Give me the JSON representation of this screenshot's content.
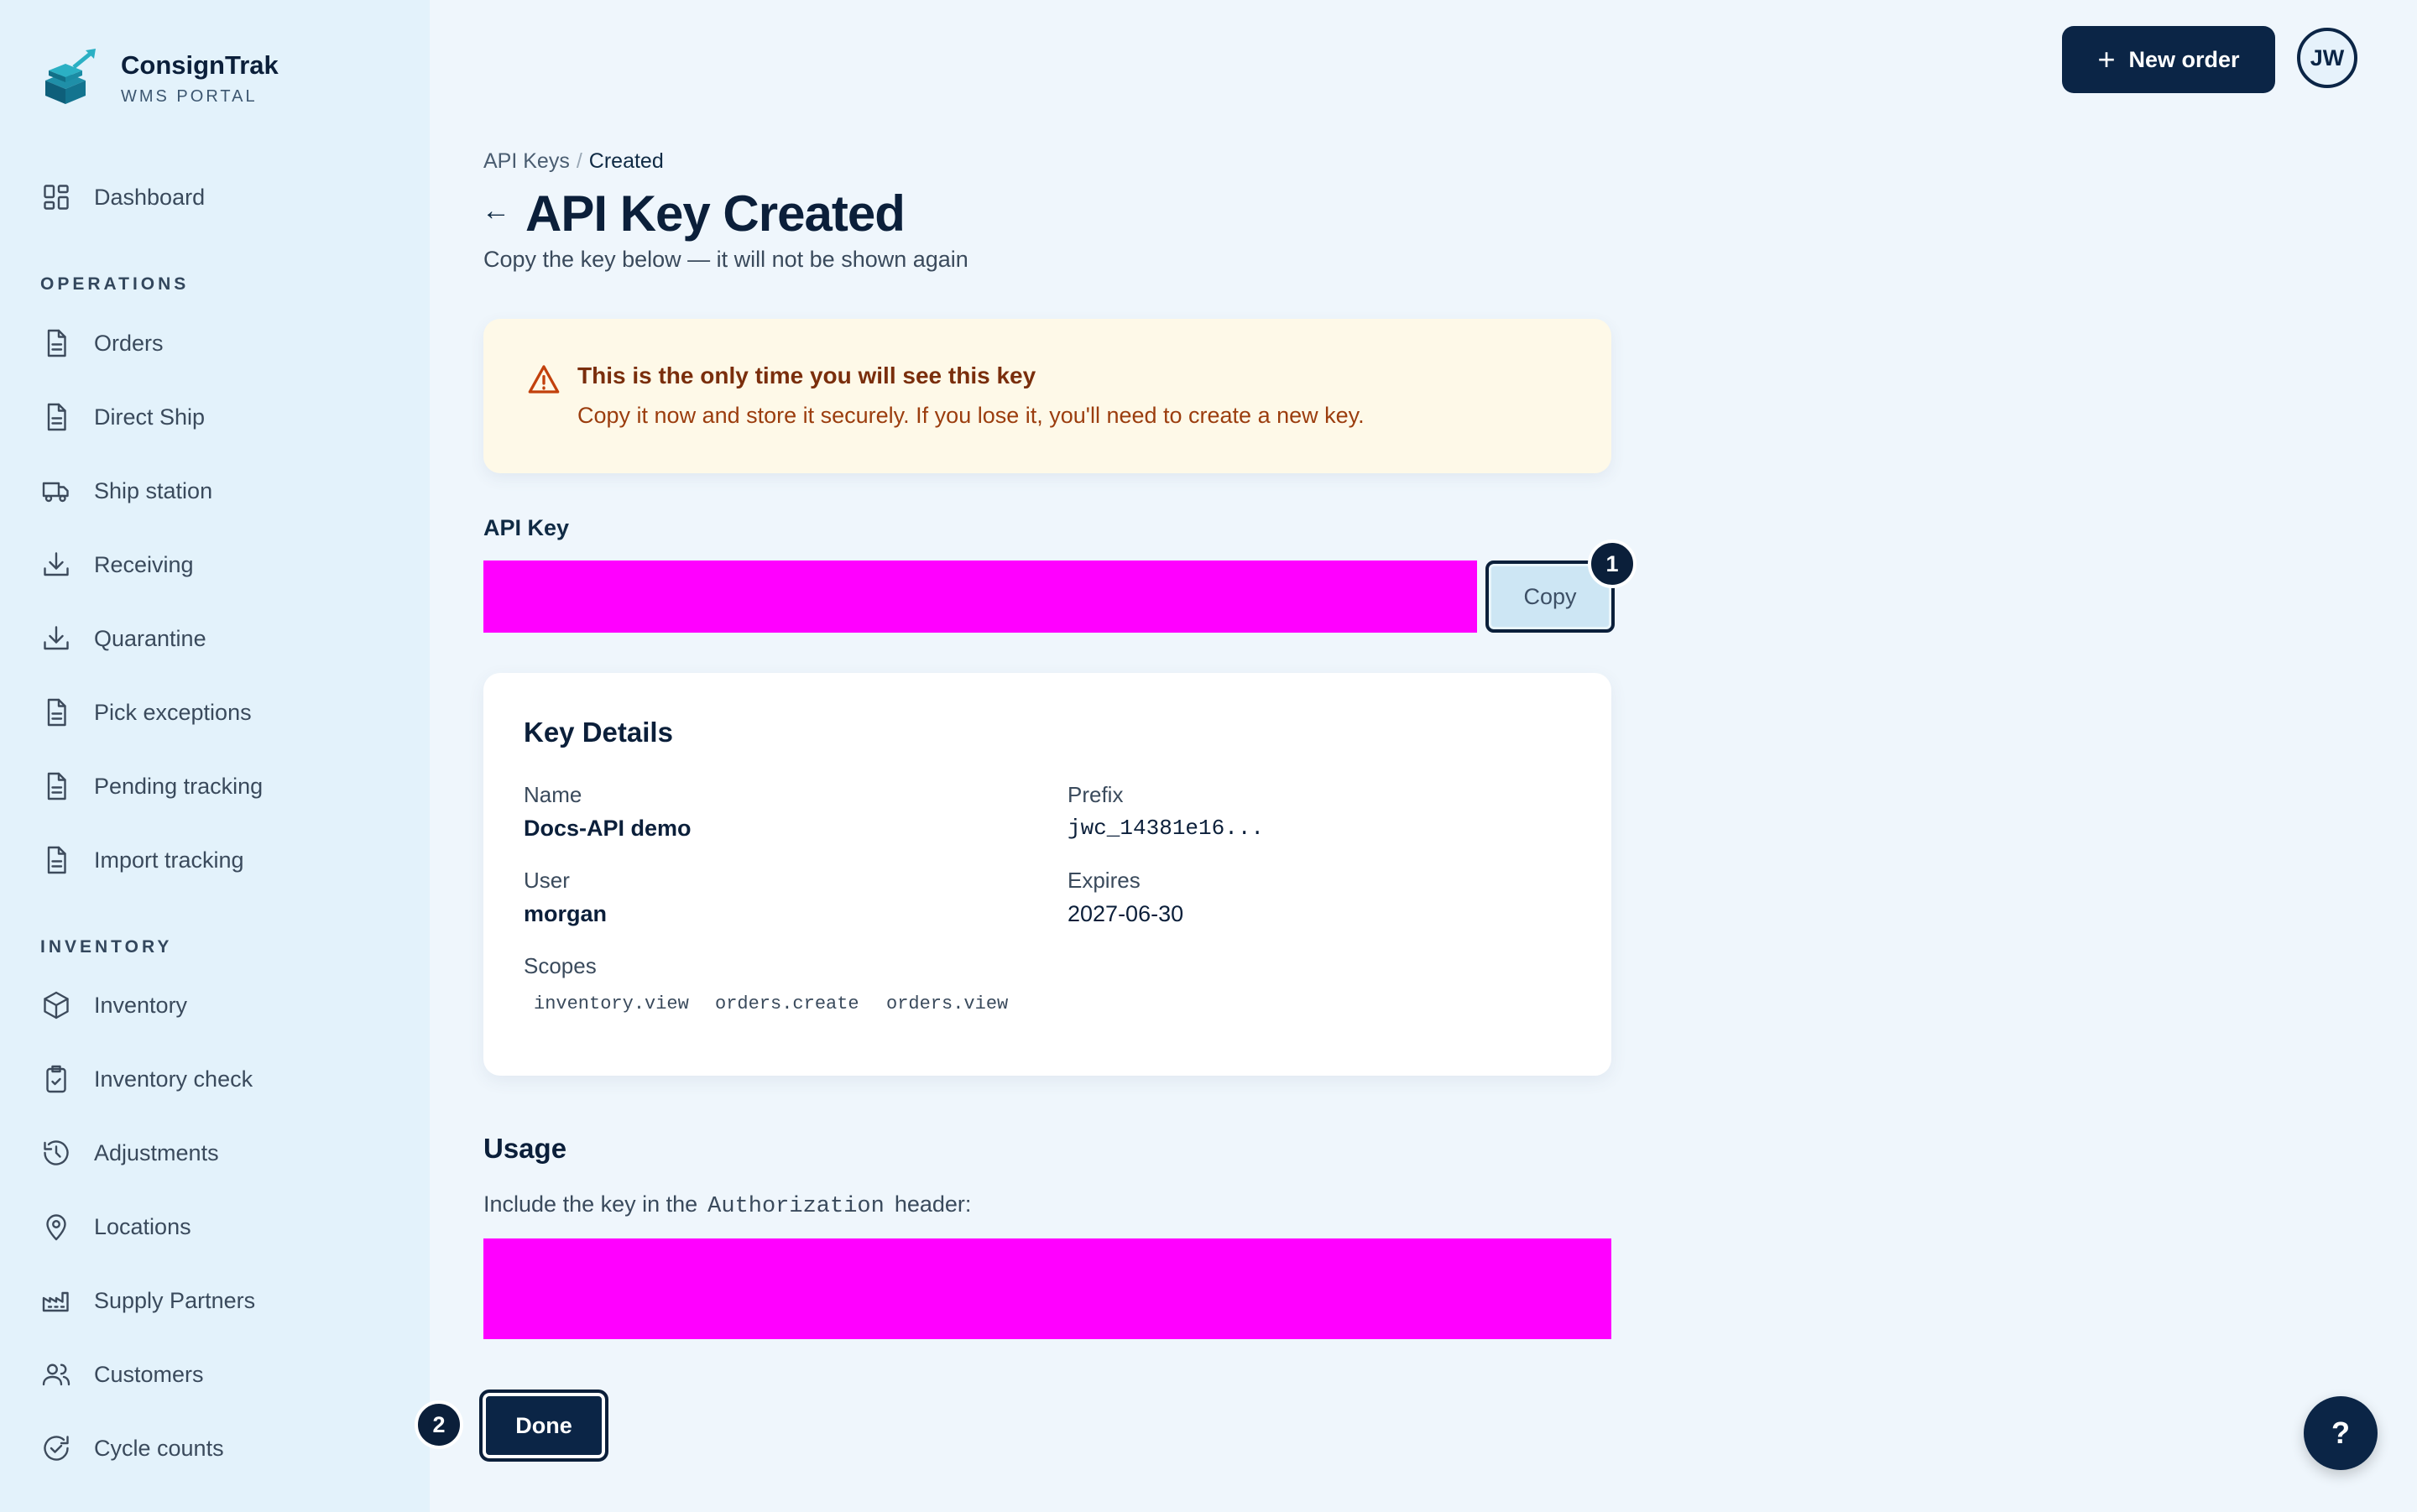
{
  "brand": {
    "name": "ConsignTrak",
    "subtitle": "WMS PORTAL",
    "logo_icon": "stacked-boxes-arrow-icon"
  },
  "sidebar": {
    "top_items": [
      {
        "label": "Dashboard",
        "icon": "dashboard-grid-icon"
      }
    ],
    "sections": [
      {
        "title": "OPERATIONS",
        "items": [
          {
            "label": "Orders",
            "icon": "document-icon"
          },
          {
            "label": "Direct Ship",
            "icon": "document-icon"
          },
          {
            "label": "Ship station",
            "icon": "truck-icon"
          },
          {
            "label": "Receiving",
            "icon": "download-tray-icon"
          },
          {
            "label": "Quarantine",
            "icon": "download-tray-icon"
          },
          {
            "label": "Pick exceptions",
            "icon": "document-icon"
          },
          {
            "label": "Pending tracking",
            "icon": "document-icon"
          },
          {
            "label": "Import tracking",
            "icon": "document-icon"
          }
        ]
      },
      {
        "title": "INVENTORY",
        "items": [
          {
            "label": "Inventory",
            "icon": "cube-icon"
          },
          {
            "label": "Inventory check",
            "icon": "clipboard-check-icon"
          },
          {
            "label": "Adjustments",
            "icon": "history-icon"
          },
          {
            "label": "Locations",
            "icon": "map-pin-icon"
          },
          {
            "label": "Supply Partners",
            "icon": "factory-icon"
          },
          {
            "label": "Customers",
            "icon": "users-icon"
          },
          {
            "label": "Cycle counts",
            "icon": "refresh-check-icon"
          }
        ]
      }
    ]
  },
  "header": {
    "new_order_label": "New order",
    "avatar_initials": "JW"
  },
  "breadcrumb": {
    "parent": "API Keys",
    "separator": "/",
    "current": "Created"
  },
  "page": {
    "title": "API Key Created",
    "subtitle": "Copy the key below — it will not be shown again"
  },
  "warning": {
    "title": "This is the only time you will see this key",
    "text": "Copy it now and store it securely. If you lose it, you'll need to create a new key."
  },
  "api_key": {
    "label": "API Key",
    "copy_label": "Copy",
    "step_badge": "1"
  },
  "details": {
    "title": "Key Details",
    "name_label": "Name",
    "name_value": "Docs-API demo",
    "prefix_label": "Prefix",
    "prefix_value": "jwc_14381e16...",
    "user_label": "User",
    "user_value": "morgan",
    "expires_label": "Expires",
    "expires_value": "2027-06-30",
    "scopes_label": "Scopes",
    "scopes": [
      "inventory.view",
      "orders.create",
      "orders.view"
    ]
  },
  "usage": {
    "title": "Usage",
    "text_before": "Include the key in the",
    "code": "Authorization",
    "text_after": "header:"
  },
  "actions": {
    "done_label": "Done",
    "step_badge": "2",
    "help_label": "?"
  },
  "colors": {
    "primary": "#0b2546",
    "redacted": "#ff00ff",
    "warning_bg": "#fef9e8",
    "warning_text": "#9b3d0e"
  }
}
